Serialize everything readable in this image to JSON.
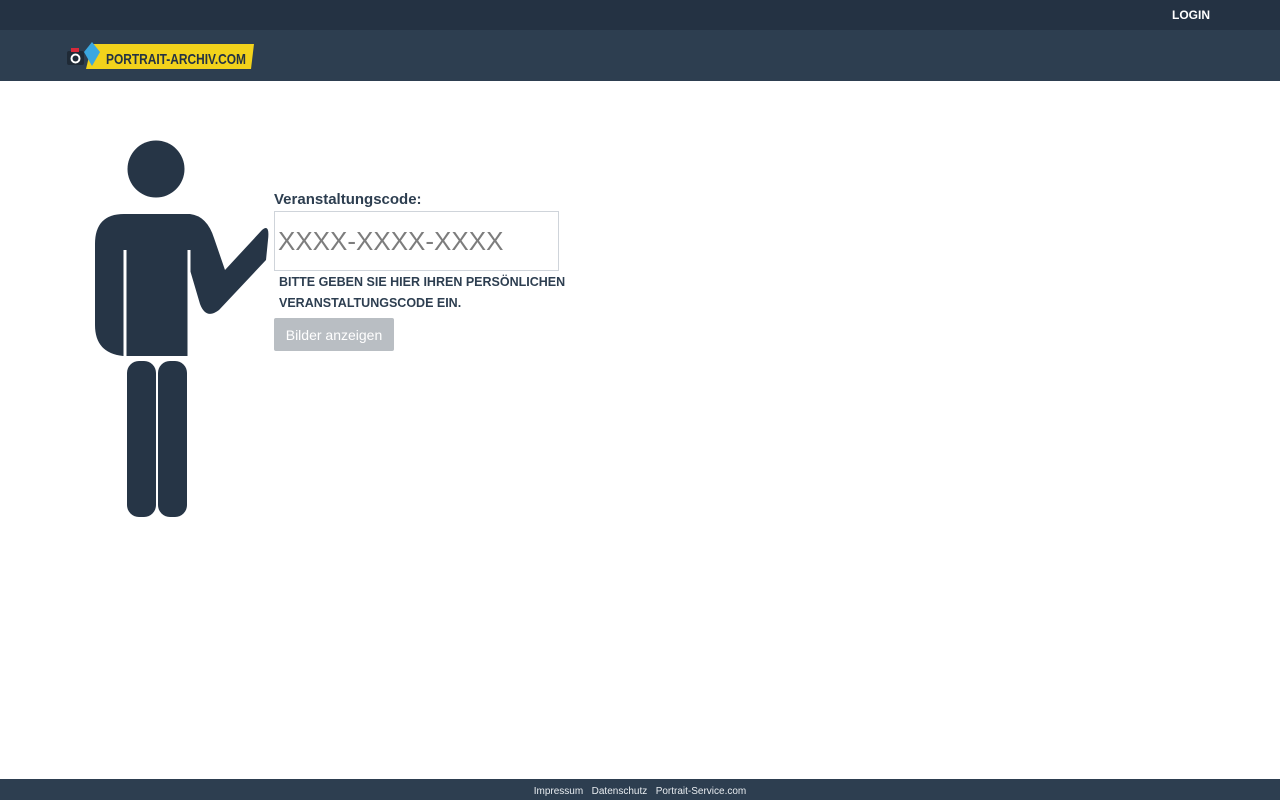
{
  "header": {
    "login_label": "LOGIN"
  },
  "logo": {
    "text": "PORTRAIT-ARCHIV.COM",
    "icon": "camera-icon",
    "colors": {
      "yellow": "#f2d21b",
      "blue": "#3aa7e0",
      "red": "#d8293a"
    }
  },
  "form": {
    "label": "Veranstaltungscode:",
    "placeholder": "XXXX-XXXX-XXXX",
    "value": "",
    "hint": "BITTE GEBEN SIE HIER IHREN PERSÖNLICHEN VERANSTALTUNGSCODE EIN.",
    "submit_label": "Bilder anzeigen"
  },
  "illustration": {
    "icon": "person-pointing-icon",
    "color": "#263546"
  },
  "footer": {
    "links": [
      "Impressum",
      "Datenschutz",
      "Portrait-Service.com"
    ]
  },
  "colors": {
    "topbar": "#243243",
    "navbar": "#2d3e50",
    "button_disabled": "#b9bec3"
  }
}
